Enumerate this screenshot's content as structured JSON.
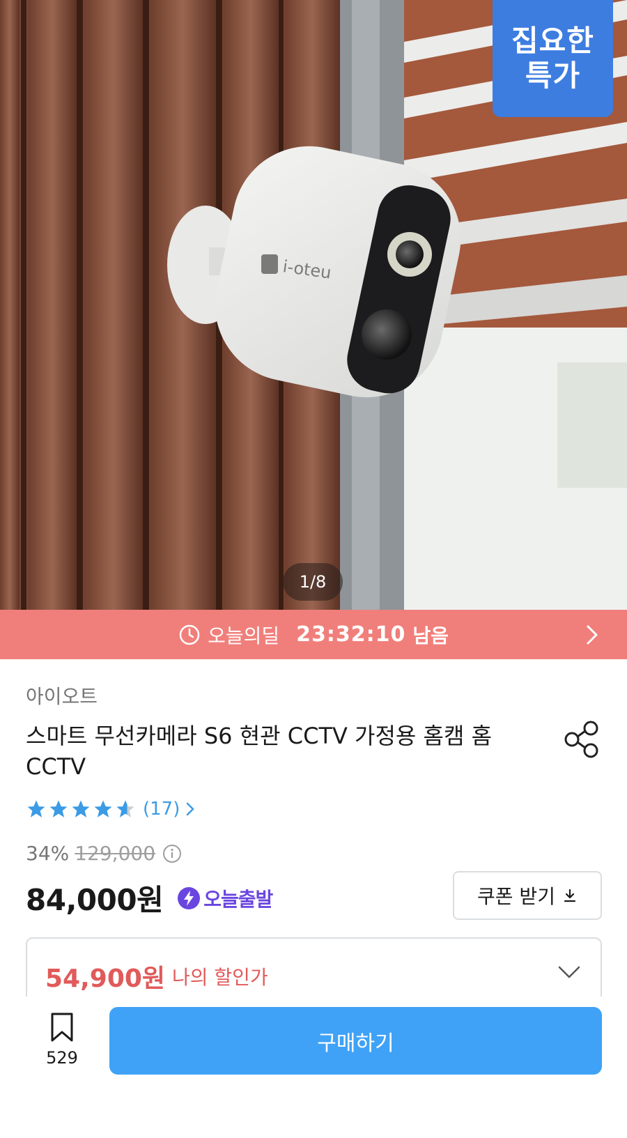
{
  "hero": {
    "badge_line1": "집요한",
    "badge_line2": "특가",
    "page_indicator": "1/8",
    "camera_brand_text": "i-oteu"
  },
  "timer": {
    "label": "오늘의딜",
    "time_remaining": "23:32:10",
    "suffix": "남음"
  },
  "product": {
    "brand": "아이오트",
    "title": "스마트 무선카메라 S6 현관 CCTV 가정용 홈캠 홈CCTV",
    "rating_stars": 4.5,
    "review_count": "(17)",
    "discount_rate": "34%",
    "original_price": "129,000",
    "price": "84,000원",
    "shipping_badge": "오늘출발",
    "coupon_label": "쿠폰 받기",
    "my_price": "54,900원",
    "my_price_label": "나의 할인가"
  },
  "bottom_bar": {
    "bookmark_count": "529",
    "buy_label": "구매하기"
  },
  "colors": {
    "timer_bar": "#f07f7b",
    "deal_badge": "#3d7de0",
    "buy_button": "#3fa2f7",
    "star": "#3b9be5",
    "my_price": "#e15a5a",
    "shipping_badge": "#6a46e0"
  }
}
